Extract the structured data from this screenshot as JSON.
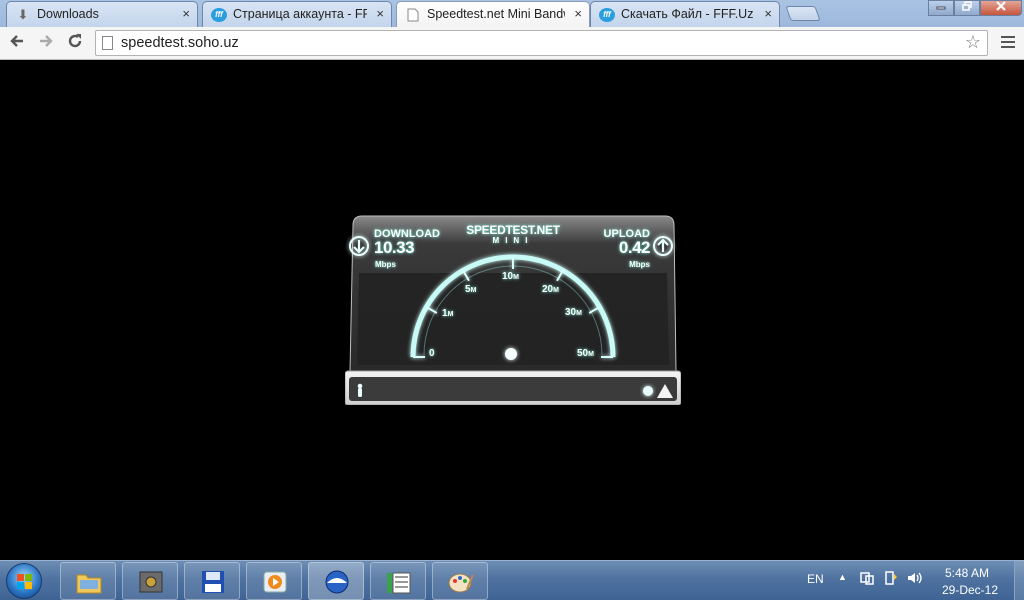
{
  "browser": {
    "tabs": [
      {
        "title": "Downloads",
        "icon": "download-icon"
      },
      {
        "title": "Страница аккаунта - FFF.",
        "icon": "fff-icon"
      },
      {
        "title": "Speedtest.net Mini Bandw",
        "icon": "page-icon"
      },
      {
        "title": "Скачать Файл - FFF.Uz",
        "icon": "fff-icon"
      }
    ],
    "active_tab": 2,
    "fff_icon_text": "fff",
    "url": "speedtest.soho.uz"
  },
  "speedtest": {
    "brand": "SPEEDTEST.NET",
    "brand_sub": "MINI",
    "download_label": "DOWNLOAD",
    "download_value": "10.33",
    "download_unit": "Mbps",
    "upload_label": "UPLOAD",
    "upload_value": "0.42",
    "upload_unit": "Mbps",
    "gauge_ticks": [
      {
        "num": "0",
        "unit": ""
      },
      {
        "num": "1",
        "unit": "M"
      },
      {
        "num": "5",
        "unit": "M"
      },
      {
        "num": "10",
        "unit": "M"
      },
      {
        "num": "20",
        "unit": "M"
      },
      {
        "num": "30",
        "unit": "M"
      },
      {
        "num": "50",
        "unit": "M"
      }
    ],
    "accent_color": "#bff6f2"
  },
  "taskbar": {
    "apps": [
      "explorer-icon",
      "safe-icon",
      "floppy-icon",
      "media-player-icon",
      "browser-icon",
      "video-editor-icon",
      "paint-icon"
    ],
    "language": "EN",
    "time": "5:48 AM",
    "date": "29-Dec-12"
  }
}
